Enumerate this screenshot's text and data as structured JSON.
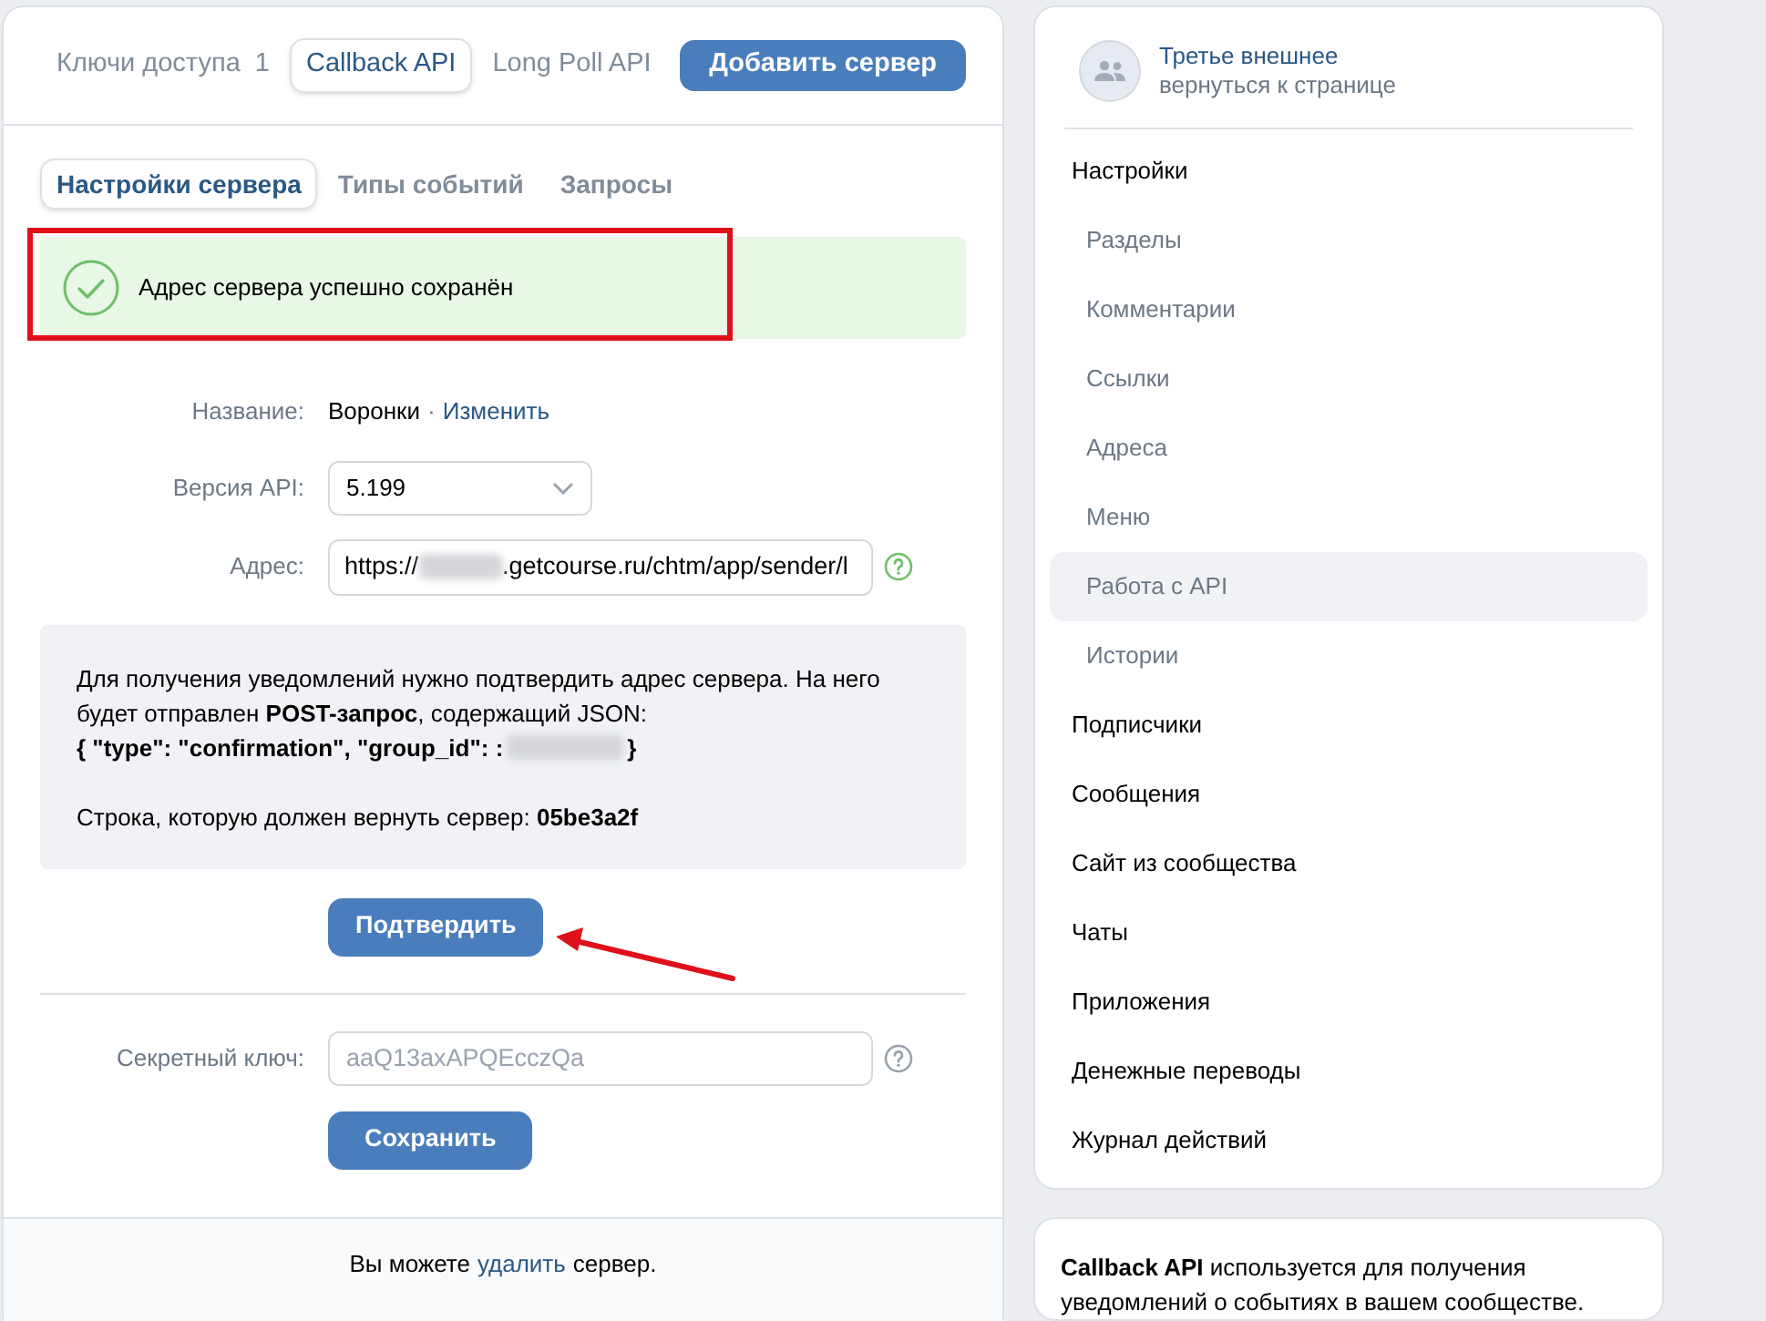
{
  "top_tabs": [
    {
      "label": "Ключи доступа",
      "count": "1",
      "selected": false
    },
    {
      "label": "Callback API",
      "selected": true
    },
    {
      "label": "Long Poll API",
      "selected": false
    }
  ],
  "add_server_button": "Добавить сервер",
  "sub_tabs": [
    {
      "label": "Настройки сервера",
      "selected": true
    },
    {
      "label": "Типы событий",
      "selected": false
    },
    {
      "label": "Запросы",
      "selected": false
    }
  ],
  "success_message": "Адрес сервера успешно сохранён",
  "form": {
    "name_label": "Название:",
    "name_value": "Воронки",
    "separator": "·",
    "change_link": "Изменить",
    "version_label": "Версия API:",
    "version_value": "5.199",
    "address_label": "Адрес:",
    "address_prefix": "https://",
    "address_suffix": ".getcourse.ru/chtm/app/sender/l"
  },
  "info": {
    "text": "Для получения уведомлений нужно подтвердить адрес сервера. На него будет отправлен **POST-запрос**, содержащий JSON:",
    "json_prefix": "{ \"type\": \"confirmation\", \"group_id\": :",
    "json_suffix": "}",
    "answer": "Строка, которую должен вернуть сервер: **05be3a2f**"
  },
  "confirm_button": "Подтвердить",
  "secret": {
    "label": "Секретный ключ:",
    "placeholder": "aaQ13axAPQEcczQa"
  },
  "save_button": "Сохранить",
  "footer": {
    "prefix": "Вы можете",
    "link": "удалить",
    "suffix": "сервер."
  },
  "sidebar": {
    "title": "Третье внешнее",
    "back_link": "вернуться к странице",
    "items": [
      {
        "label": "Настройки",
        "selected": false,
        "children": [
          {
            "label": "Разделы",
            "selected": false
          },
          {
            "label": "Комментарии",
            "selected": false
          },
          {
            "label": "Ссылки",
            "selected": false
          },
          {
            "label": "Адреса",
            "selected": false
          },
          {
            "label": "Меню",
            "selected": false
          },
          {
            "label": "Работа с API",
            "selected": true
          },
          {
            "label": "Истории",
            "selected": false
          }
        ]
      },
      {
        "label": "Подписчики",
        "selected": false
      },
      {
        "label": "Сообщения",
        "selected": false
      },
      {
        "label": "Сайт из сообщества",
        "selected": false
      },
      {
        "label": "Чаты",
        "selected": false
      },
      {
        "label": "Приложения",
        "selected": false
      },
      {
        "label": "Денежные переводы",
        "selected": false
      },
      {
        "label": "Журнал действий",
        "selected": false
      }
    ]
  },
  "about": "**Callback API** используется для получения уведомлений о событиях в вашем сообществе."
}
